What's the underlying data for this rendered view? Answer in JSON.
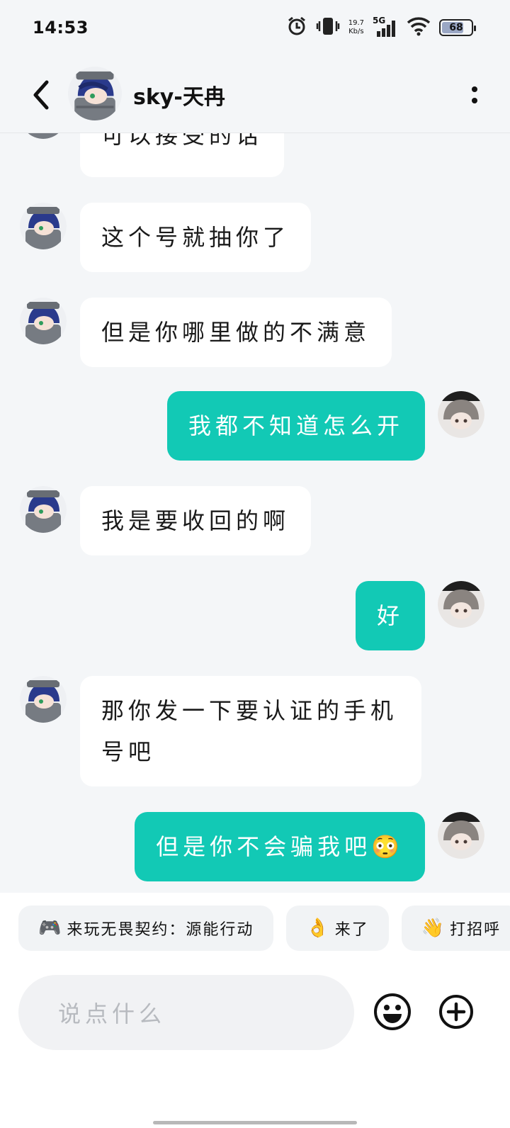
{
  "status_bar": {
    "time": "14:53",
    "net_speed_value": "19.7",
    "net_speed_unit": "Kb/s",
    "network": "5G",
    "battery": "68"
  },
  "header": {
    "title": "sky-天冉"
  },
  "messages": [
    {
      "from": "other",
      "text": "可以接受的话"
    },
    {
      "from": "other",
      "text": "这个号就抽你了"
    },
    {
      "from": "other",
      "text": "但是你哪里做的不满意"
    },
    {
      "from": "me",
      "text": "我都不知道怎么开"
    },
    {
      "from": "other",
      "text": "我是要收回的啊"
    },
    {
      "from": "me",
      "text": "好"
    },
    {
      "from": "other",
      "text": "那你发一下要认证的手机号吧"
    },
    {
      "from": "me",
      "text": "但是你不会骗我吧😳"
    }
  ],
  "quick_replies": [
    {
      "icon": "🎮",
      "label": "来玩无畏契约：源能行动"
    },
    {
      "icon": "👌",
      "label": "来了"
    },
    {
      "icon": "👋",
      "label": "打招呼"
    }
  ],
  "input": {
    "placeholder": "说点什么"
  },
  "colors": {
    "outgoing_bubble": "#12c9b5",
    "incoming_bubble": "#ffffff",
    "background": "#f4f6f8"
  }
}
